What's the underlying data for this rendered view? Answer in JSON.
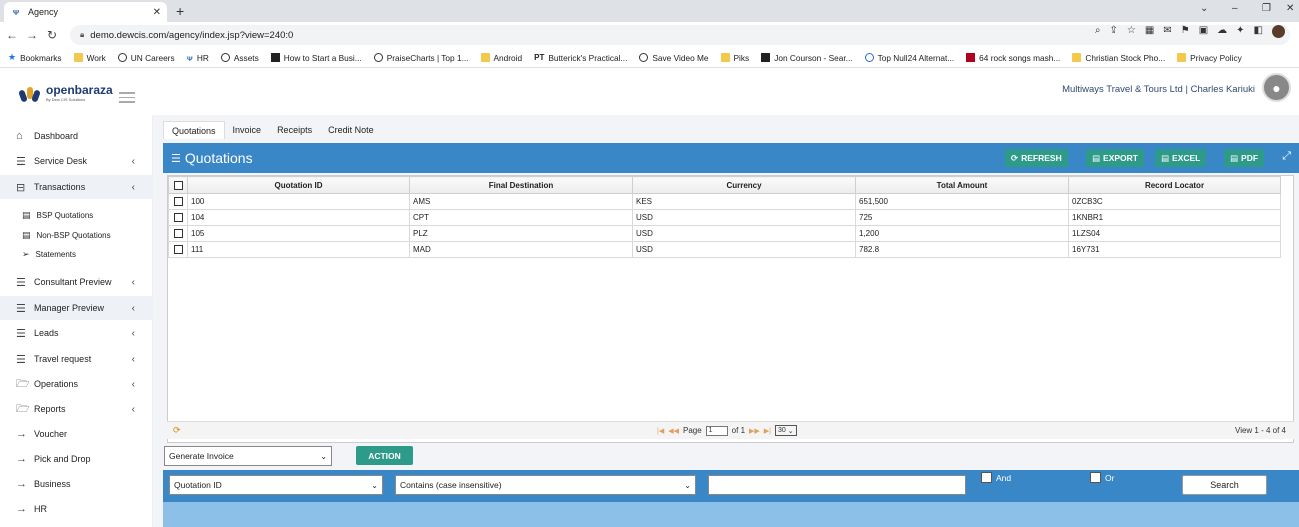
{
  "browser": {
    "tab_title": "Agency",
    "tab_close": "✕",
    "new_tab": "+",
    "url": "demo.dewcis.com/agency/index.jsp?view=240:0",
    "bookmarks": [
      {
        "label": "Bookmarks",
        "icon": "star-icon"
      },
      {
        "label": "Work",
        "icon": "folder-icon"
      },
      {
        "label": "UN Careers",
        "icon": "globe-icon"
      },
      {
        "label": "HR",
        "icon": "agency-icon"
      },
      {
        "label": "Assets",
        "icon": "globe-icon"
      },
      {
        "label": "How to Start a Busi...",
        "icon": "grid-icon"
      },
      {
        "label": "PraiseCharts | Top 1...",
        "icon": "play-icon"
      },
      {
        "label": "Android",
        "icon": "folder-icon"
      },
      {
        "label": "Butterick's Practical...",
        "icon": "pt-icon"
      },
      {
        "label": "Save Video Me",
        "icon": "globe-icon"
      },
      {
        "label": "Piks",
        "icon": "folder-icon"
      },
      {
        "label": "Jon Courson - Sear...",
        "icon": "grid-icon"
      },
      {
        "label": "Top Null24 Alternat...",
        "icon": "blue-circle-icon"
      },
      {
        "label": "64 rock songs mash...",
        "icon": "red-square-icon"
      },
      {
        "label": "Christian Stock Pho...",
        "icon": "folder-icon"
      },
      {
        "label": "Privacy Policy",
        "icon": "folder-icon"
      }
    ]
  },
  "header": {
    "logo_text": "openbaraza",
    "logo_sub": "By Dew CIS Solutions",
    "company_user": "Multiways Travel & Tours Ltd | Charles Kariuki"
  },
  "sidebar": {
    "items": [
      {
        "label": "Dashboard",
        "icon": "home-icon",
        "chevron": false
      },
      {
        "label": "Service Desk",
        "icon": "list-icon",
        "chevron": true
      },
      {
        "label": "Transactions",
        "icon": "briefcase-icon",
        "chevron": true
      },
      {
        "label": "Consultant Preview",
        "icon": "list-icon",
        "chevron": true
      },
      {
        "label": "Manager Preview",
        "icon": "list-icon",
        "chevron": true
      },
      {
        "label": "Leads",
        "icon": "list-icon",
        "chevron": true
      },
      {
        "label": "Travel request",
        "icon": "list-icon",
        "chevron": true
      },
      {
        "label": "Operations",
        "icon": "folder-open-icon",
        "chevron": true
      },
      {
        "label": "Reports",
        "icon": "folder-open-icon",
        "chevron": true
      },
      {
        "label": "Voucher",
        "icon": "arrow-right-icon",
        "chevron": false
      },
      {
        "label": "Pick and Drop",
        "icon": "arrow-right-icon",
        "chevron": false
      },
      {
        "label": "Business",
        "icon": "arrow-right-icon",
        "chevron": false
      },
      {
        "label": "HR",
        "icon": "arrow-right-icon",
        "chevron": false
      }
    ],
    "sub_items": [
      {
        "label": "BSP Quotations",
        "icon": "document-icon"
      },
      {
        "label": "Non-BSP Quotations",
        "icon": "document-icon"
      },
      {
        "label": "Statements",
        "icon": "send-icon"
      }
    ],
    "chevron": "‹"
  },
  "main": {
    "tabs": [
      "Quotations",
      "Invoice",
      "Receipts",
      "Credit Note"
    ],
    "panel_title": "Quotations",
    "buttons": {
      "refresh": "REFRESH",
      "export": "EXPORT",
      "excel": "EXCEL",
      "pdf": "PDF"
    },
    "table": {
      "columns": [
        "Quotation ID",
        "Final Destination",
        "Currency",
        "Total Amount",
        "Record Locator"
      ],
      "rows": [
        [
          "100",
          "AMS",
          "KES",
          "651,500",
          "0ZCB3C"
        ],
        [
          "104",
          "CPT",
          "USD",
          "725",
          "1KNBR1"
        ],
        [
          "105",
          "PLZ",
          "USD",
          "1,200",
          "1LZS04"
        ],
        [
          "111",
          "MAD",
          "USD",
          "782.8",
          "16Y731"
        ]
      ]
    },
    "pager": {
      "page_label": "Page",
      "page_value": "1",
      "of_label": "of 1",
      "rows_per_page": "30",
      "view_text": "View 1 - 4 of 4"
    },
    "action": {
      "selected": "Generate Invoice",
      "button": "ACTION"
    },
    "search": {
      "field_selected": "Quotation ID",
      "operator_selected": "Contains (case insensitive)",
      "value": "",
      "and_label": "And",
      "or_label": "Or",
      "button": "Search"
    }
  },
  "colors": {
    "header_blue": "#3a87c8",
    "teal_button": "#2e9a8a",
    "footer_light_blue": "#8cc0e8"
  }
}
